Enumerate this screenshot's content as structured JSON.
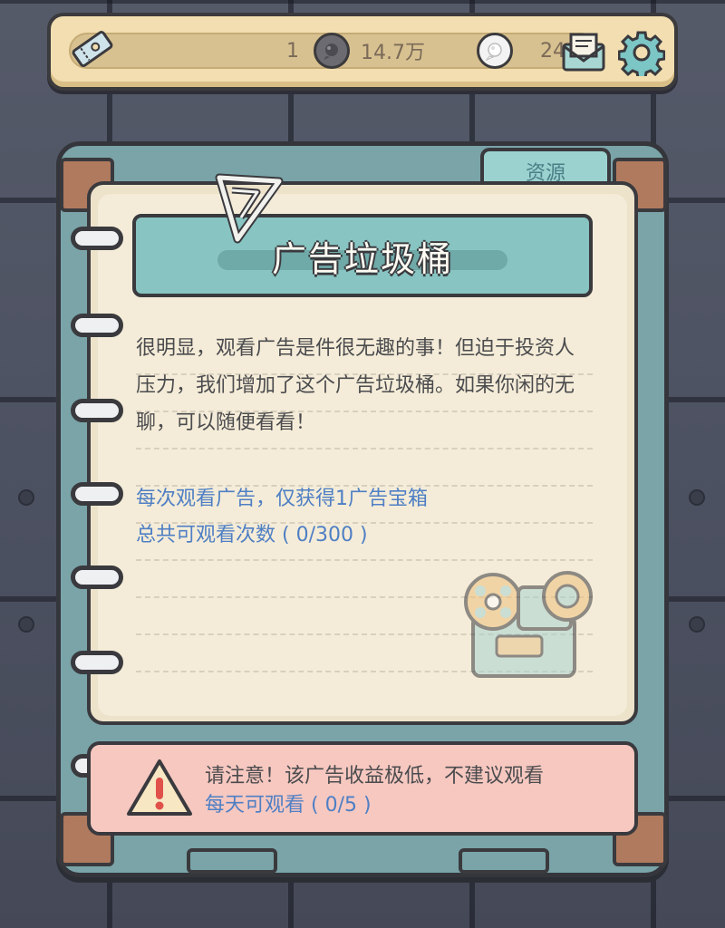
{
  "topbar": {
    "ticket_value": "1",
    "coin_value": "14.7万",
    "gem_value": "244",
    "icons": [
      "ticket-icon",
      "coin-icon",
      "gem-icon",
      "mail-icon",
      "gear-icon"
    ]
  },
  "tabs": {
    "resources_label": "资源"
  },
  "panel": {
    "title": "广告垃圾桶",
    "description": "很明显，观看广告是件很无趣的事！但迫于投资人压力，我们增加了这个广告垃圾桶。如果你闲的无聊，可以随便看看！",
    "reward_text": "每次观看广告，仅获得1广告宝箱",
    "total_count_text": "总共可观看次数 ( 0/300 )"
  },
  "warning": {
    "notice_text": "请注意！该广告收益极低，不建议观看",
    "daily_count_text": "每天可观看 ( 0/5 )"
  },
  "colors": {
    "accent_blue_text": "#4f7fc4",
    "banner_teal": "#88c4c2",
    "warning_pink": "#f6c8c0",
    "paper": "#f4ecd8"
  }
}
